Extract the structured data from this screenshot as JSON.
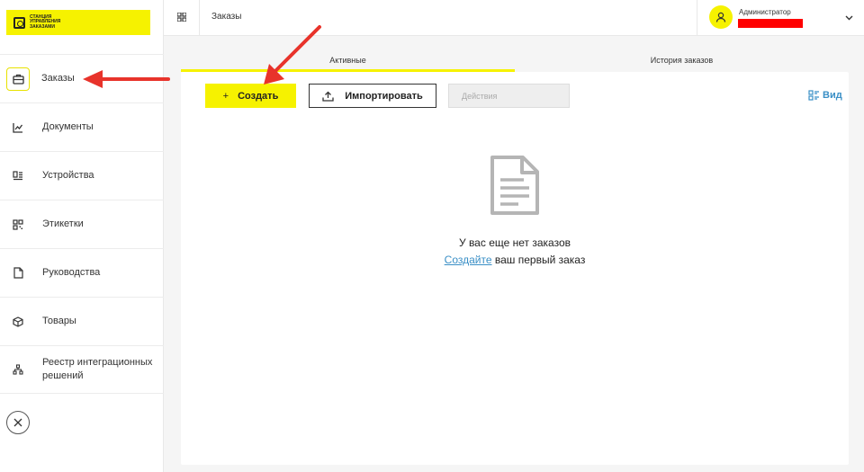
{
  "logo": {
    "text": "Станция\nуправления\nзаказами"
  },
  "sidebar": {
    "items": [
      {
        "label": "Заказы",
        "icon": "briefcase-icon",
        "active": true
      },
      {
        "label": "Документы",
        "icon": "chart-icon"
      },
      {
        "label": "Устройства",
        "icon": "devices-icon"
      },
      {
        "label": "Этикетки",
        "icon": "qr-icon"
      },
      {
        "label": "Руководства",
        "icon": "file-icon"
      },
      {
        "label": "Товары",
        "icon": "box-icon"
      },
      {
        "label": "Реестр интеграционных решений",
        "icon": "hierarchy-icon"
      }
    ],
    "close_icon": "close-icon"
  },
  "header": {
    "title": "Заказы",
    "user_role": "Администратор"
  },
  "tabs": [
    {
      "label": "Активные",
      "active": true
    },
    {
      "label": "История заказов",
      "active": false
    }
  ],
  "toolbar": {
    "create_label": "Создать",
    "import_label": "Импортировать",
    "actions_placeholder": "Действия",
    "view_label": "Вид"
  },
  "empty_state": {
    "title": "У вас еще нет заказов",
    "link_text": "Создайте",
    "rest_text": " ваш первый заказ"
  },
  "colors": {
    "accent": "#f6f200",
    "link": "#3a8fc6",
    "annotation": "#e8332b"
  }
}
